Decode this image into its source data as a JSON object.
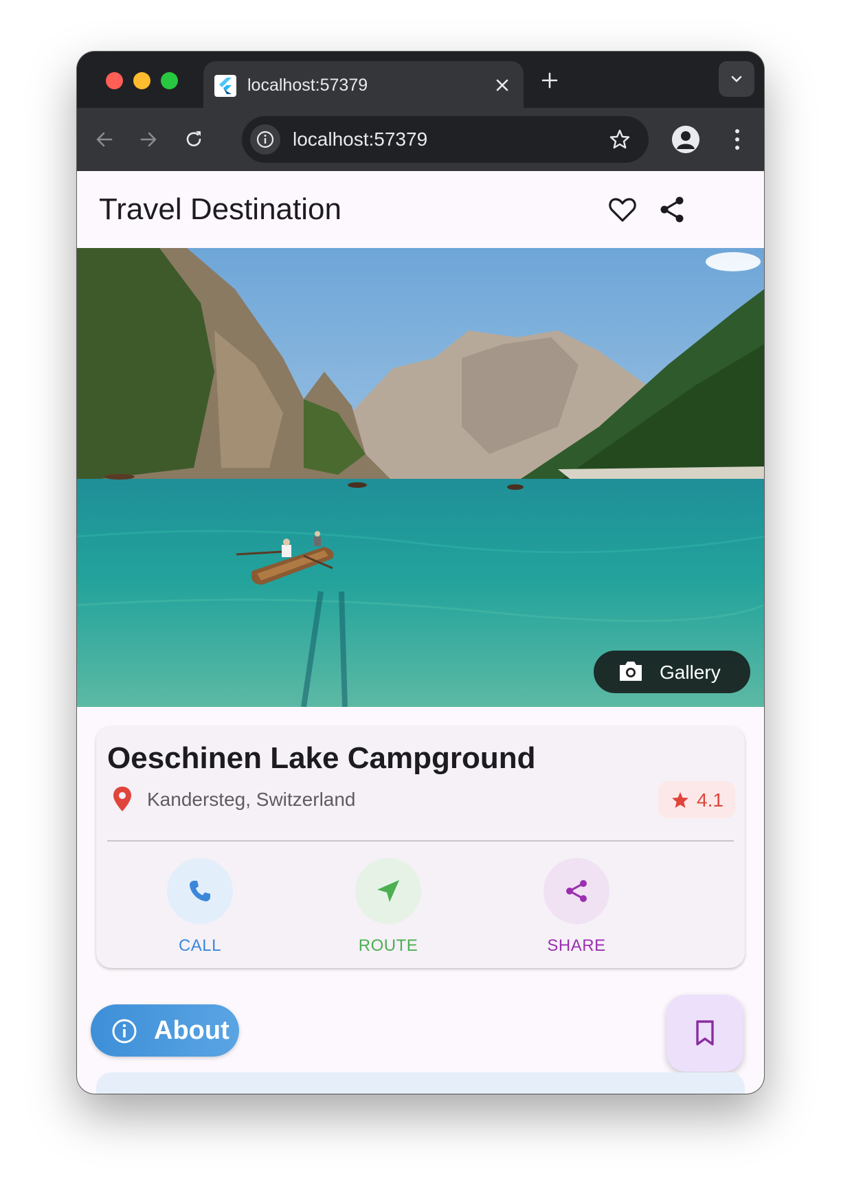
{
  "browser": {
    "tab_title": "localhost:57379",
    "url": "localhost:57379"
  },
  "app": {
    "title": "Travel Destination"
  },
  "hero": {
    "gallery_label": "Gallery"
  },
  "place": {
    "name": "Oeschinen Lake Campground",
    "location": "Kandersteg, Switzerland",
    "rating": "4.1"
  },
  "actions": [
    {
      "label": "CALL",
      "color": "#3b87d9",
      "bg": "#e3eefb"
    },
    {
      "label": "ROUTE",
      "color": "#4caf50",
      "bg": "#e6f2e6"
    },
    {
      "label": "SHARE",
      "color": "#9c2fb0",
      "bg": "#f0e1f3"
    }
  ],
  "about": {
    "label": "About"
  },
  "colors": {
    "accent_red": "#e0453c",
    "about_blue": "#3d8fd8",
    "fab_purple": "#8a2da0"
  }
}
